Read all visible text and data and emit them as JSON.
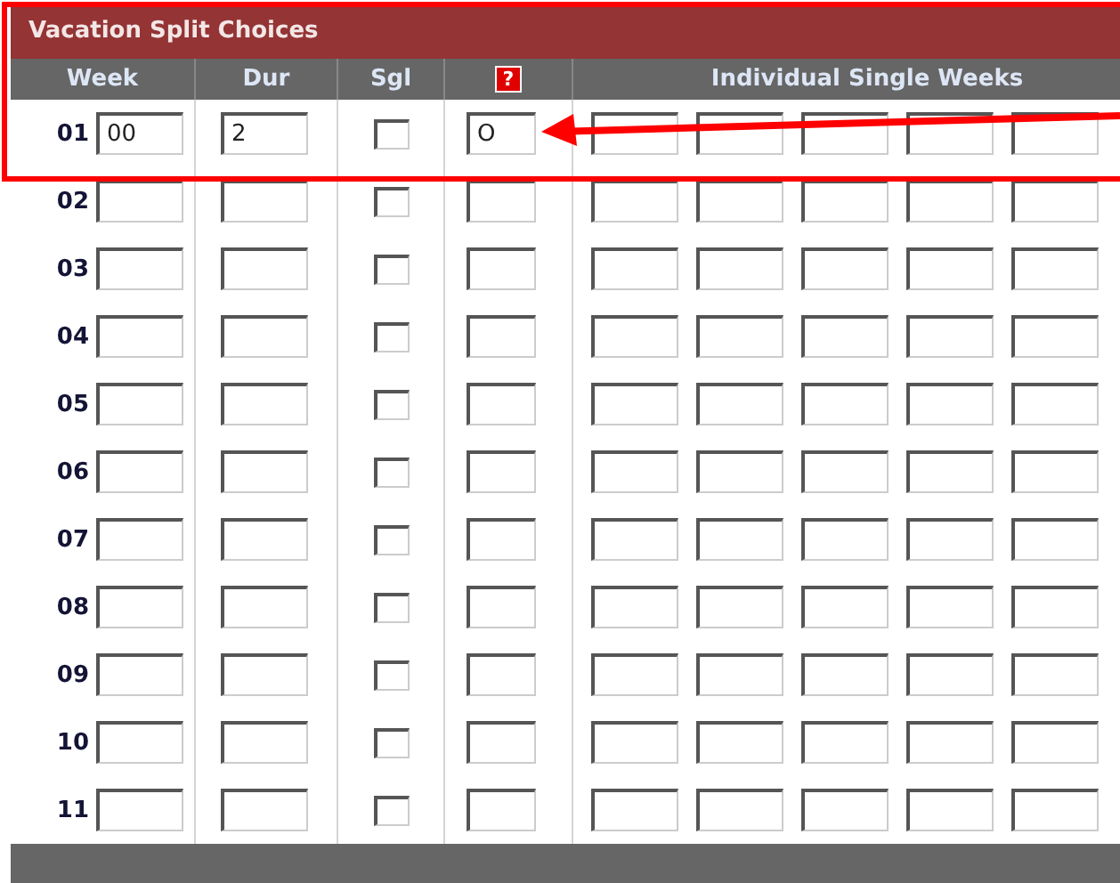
{
  "panel": {
    "title": "Vacation Split Choices"
  },
  "columns": [
    {
      "kind": "text",
      "label": "Week"
    },
    {
      "kind": "text",
      "label": "Dur"
    },
    {
      "kind": "text",
      "label": "Sgl"
    },
    {
      "kind": "help",
      "label": "?"
    },
    {
      "kind": "text",
      "label": "Individual Single Weeks"
    }
  ],
  "rows": [
    {
      "label": "01",
      "week": "00",
      "dur": "2",
      "single_checked": false,
      "code": "O"
    },
    {
      "label": "02",
      "single_checked": false
    },
    {
      "label": "03",
      "single_checked": false
    },
    {
      "label": "04",
      "single_checked": false
    },
    {
      "label": "05",
      "single_checked": false
    },
    {
      "label": "06",
      "single_checked": false
    },
    {
      "label": "07",
      "single_checked": false
    },
    {
      "label": "08",
      "single_checked": false
    },
    {
      "label": "09",
      "single_checked": false
    },
    {
      "label": "10",
      "single_checked": false
    },
    {
      "label": "11",
      "single_checked": false
    }
  ]
}
